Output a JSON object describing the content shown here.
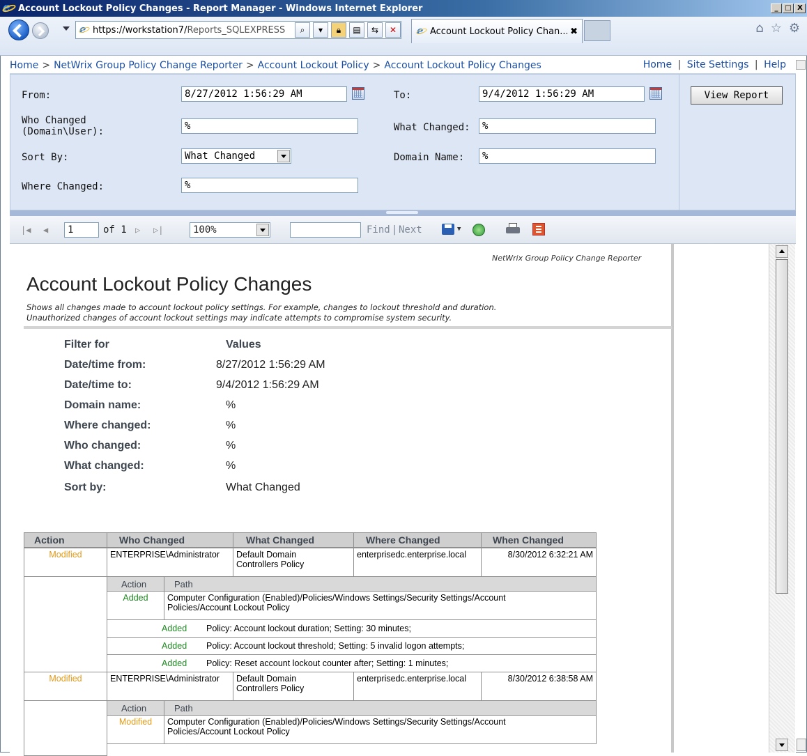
{
  "window": {
    "title": "Account Lockout Policy Changes - Report Manager - Windows Internet Explorer",
    "controls": {
      "minimize": "_",
      "maximize": "□",
      "close": "X"
    }
  },
  "browser": {
    "address_host": "https://workstation7/",
    "address_path": "Reports_SQLEXPRESS",
    "tab_title": "Account Lockout Policy Chan...",
    "tab_close": "✖",
    "icons": [
      "home-icon",
      "favorites-star-icon",
      "tools-gear-icon"
    ]
  },
  "breadcrumb": {
    "items": [
      "Home",
      "NetWrix Group Policy Change Reporter",
      "Account Lockout Policy",
      "Account Lockout Policy Changes"
    ],
    "separator": ">",
    "right_links": [
      "Home",
      "Site Settings",
      "Help"
    ],
    "right_separator": "|"
  },
  "params": {
    "from_label": "From:",
    "from_value": "8/27/2012 1:56:29 AM",
    "to_label": "To:",
    "to_value": "9/4/2012 1:56:29 AM",
    "who_label_1": "Who Changed",
    "who_label_2": "(Domain\\User):",
    "who_value": "%",
    "what_label": "What Changed:",
    "what_value": "%",
    "sort_label": "Sort By:",
    "sort_value": "What Changed",
    "domain_label": "Domain Name:",
    "domain_value": "%",
    "where_label": "Where Changed:",
    "where_value": "%",
    "view_report": "View Report"
  },
  "toolbar": {
    "page_value": "1",
    "of_text": "of 1",
    "zoom_value": "100%",
    "search_value": "",
    "find": "Find",
    "sep": "|",
    "next": "Next"
  },
  "report": {
    "brand": "NetWrix Group Policy Change Reporter",
    "title": "Account Lockout Policy Changes",
    "desc_line1": "Shows all changes made to account lockout policy settings. For example, changes to lockout threshold and duration.",
    "desc_line2": "Unauthorized changes of account lockout settings may indicate attempts to compromise system security.",
    "filter_header_key": "Filter for",
    "filter_header_value": "Values",
    "filters": [
      {
        "key": "Date/time from:",
        "value": "8/27/2012 1:56:29 AM"
      },
      {
        "key": "Date/time to:",
        "value": "9/4/2012 1:56:29 AM"
      },
      {
        "key": "Domain name:",
        "value": "%"
      },
      {
        "key": "Where changed:",
        "value": "%"
      },
      {
        "key": "Who changed:",
        "value": "%"
      },
      {
        "key": "What changed:",
        "value": "%"
      },
      {
        "key": "Sort by:",
        "value": "What Changed"
      }
    ],
    "columns": [
      "Action",
      "Who Changed",
      "What Changed",
      "Where Changed",
      "When Changed"
    ],
    "sub_columns": [
      "Action",
      "Path"
    ],
    "rows": [
      {
        "action": "Modified",
        "who": "ENTERPRISE\\Administrator",
        "what_1": "Default Domain",
        "what_2": "Controllers Policy",
        "where": "enterprisedc.enterprise.local",
        "when": "8/30/2012 6:32:21 AM",
        "detail_action": "Added",
        "detail_path_1": "Computer Configuration (Enabled)/Policies/Windows Settings/Security Settings/Account",
        "detail_path_2": "Policies/Account Lockout Policy",
        "settings": [
          {
            "action": "Added",
            "text": "Policy: Account lockout duration; Setting: 30 minutes;"
          },
          {
            "action": "Added",
            "text": "Policy: Account lockout threshold; Setting: 5 invalid logon attempts;"
          },
          {
            "action": "Added",
            "text": "Policy: Reset account lockout counter after; Setting: 1 minutes;"
          }
        ]
      },
      {
        "action": "Modified",
        "who": "ENTERPRISE\\Administrator",
        "what_1": "Default Domain",
        "what_2": "Controllers Policy",
        "where": "enterprisedc.enterprise.local",
        "when": "8/30/2012 6:38:58 AM",
        "detail_action": "Modified",
        "detail_path_1": "Computer Configuration (Enabled)/Policies/Windows Settings/Security Settings/Account",
        "detail_path_2": "Policies/Account Lockout Policy"
      }
    ]
  },
  "colors": {
    "modified": "#e39a17",
    "added": "#1f8a22",
    "link": "#1c4fa3",
    "param_bg": "#dde6f5"
  }
}
